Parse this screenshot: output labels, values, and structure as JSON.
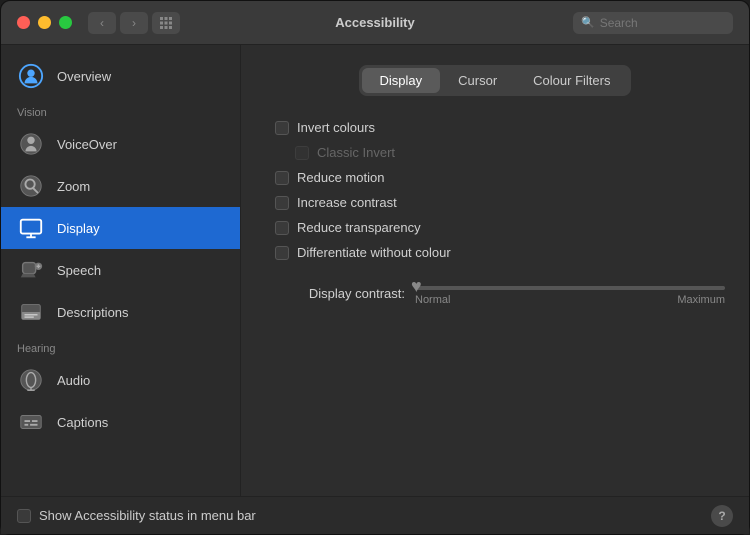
{
  "titleBar": {
    "title": "Accessibility",
    "searchPlaceholder": "Search",
    "backBtn": "‹",
    "forwardBtn": "›"
  },
  "sidebar": {
    "sections": [],
    "items": [
      {
        "id": "overview",
        "label": "Overview",
        "icon": "person-circle",
        "active": false,
        "section": null
      },
      {
        "id": "voiceover",
        "label": "VoiceOver",
        "icon": "voiceover",
        "active": false,
        "section": "Vision"
      },
      {
        "id": "zoom",
        "label": "Zoom",
        "icon": "zoom",
        "active": false,
        "section": null
      },
      {
        "id": "display",
        "label": "Display",
        "icon": "display",
        "active": true,
        "section": null
      },
      {
        "id": "speech",
        "label": "Speech",
        "icon": "speech",
        "active": false,
        "section": null
      },
      {
        "id": "descriptions",
        "label": "Descriptions",
        "icon": "descriptions",
        "active": false,
        "section": null
      },
      {
        "id": "audio",
        "label": "Audio",
        "icon": "audio",
        "active": false,
        "section": "Hearing"
      },
      {
        "id": "captions",
        "label": "Captions",
        "icon": "captions",
        "active": false,
        "section": null
      }
    ]
  },
  "content": {
    "tabs": [
      {
        "id": "display",
        "label": "Display",
        "active": true
      },
      {
        "id": "cursor",
        "label": "Cursor",
        "active": false
      },
      {
        "id": "colour-filters",
        "label": "Colour Filters",
        "active": false
      }
    ],
    "options": [
      {
        "id": "invert-colours",
        "label": "Invert colours",
        "checked": false,
        "disabled": false,
        "indent": 0
      },
      {
        "id": "classic-invert",
        "label": "Classic Invert",
        "checked": false,
        "disabled": true,
        "indent": 1
      },
      {
        "id": "reduce-motion",
        "label": "Reduce motion",
        "checked": false,
        "disabled": false,
        "indent": 0
      },
      {
        "id": "increase-contrast",
        "label": "Increase contrast",
        "checked": false,
        "disabled": false,
        "indent": 0
      },
      {
        "id": "reduce-transparency",
        "label": "Reduce transparency",
        "checked": false,
        "disabled": false,
        "indent": 0
      },
      {
        "id": "differentiate-without-colour",
        "label": "Differentiate without colour",
        "checked": false,
        "disabled": false,
        "indent": 0
      }
    ],
    "slider": {
      "label": "Display contrast:",
      "normalLabel": "Normal",
      "maximumLabel": "Maximum",
      "value": 0
    }
  },
  "bottomBar": {
    "checkboxLabel": "Show Accessibility status in menu bar",
    "helpLabel": "?"
  }
}
